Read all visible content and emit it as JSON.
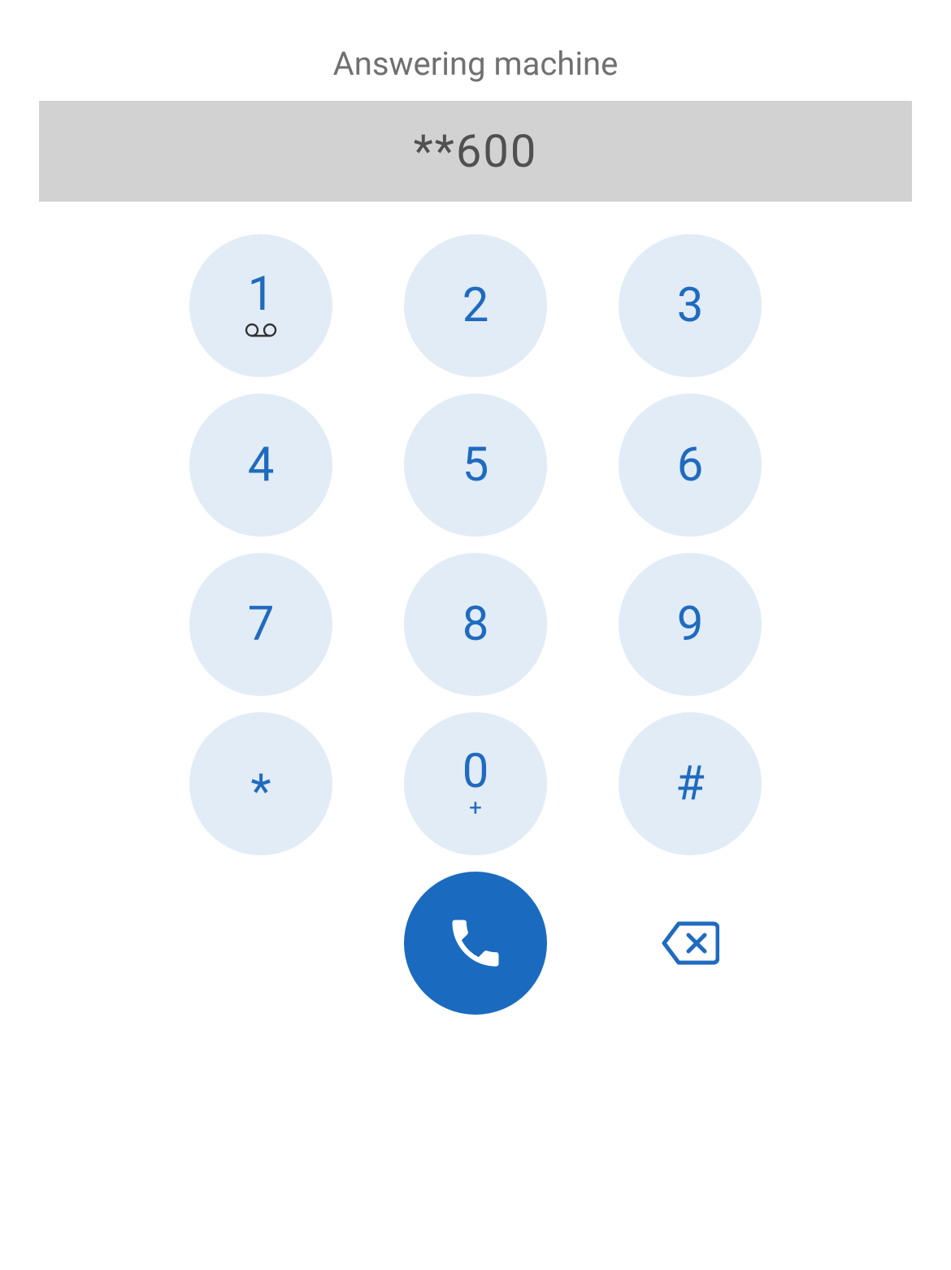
{
  "title": "Answering machine",
  "display": "**600",
  "keys": {
    "k1": {
      "main": "1",
      "sub_icon": "voicemail"
    },
    "k2": {
      "main": "2"
    },
    "k3": {
      "main": "3"
    },
    "k4": {
      "main": "4"
    },
    "k5": {
      "main": "5"
    },
    "k6": {
      "main": "6"
    },
    "k7": {
      "main": "7"
    },
    "k8": {
      "main": "8"
    },
    "k9": {
      "main": "9"
    },
    "kstar": {
      "main": "*"
    },
    "k0": {
      "main": "0",
      "sub": "+"
    },
    "khash": {
      "main": "#"
    }
  },
  "icons": {
    "call": "phone-icon",
    "backspace": "backspace-icon",
    "voicemail": "voicemail-icon"
  },
  "colors": {
    "key_bg": "#e2ecf6",
    "key_text": "#1f6bbf",
    "call_bg": "#1a6bbf",
    "display_bg": "#d2d2d2",
    "display_text": "#505050",
    "title_text": "#707070"
  }
}
